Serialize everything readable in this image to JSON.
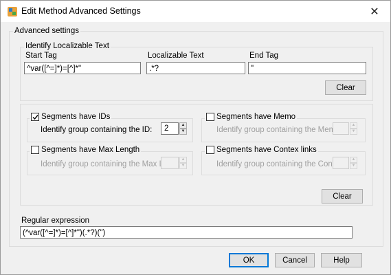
{
  "window": {
    "title": "Edit Method Advanced Settings",
    "close": "✕"
  },
  "advanced": {
    "label": "Advanced settings"
  },
  "localizable": {
    "label": "Identify Localizable Text",
    "start_tag_label": "Start Tag",
    "start_tag_value": "^var([^=]*)=[^]*\"",
    "text_label": "Localizable Text",
    "text_value": ".*?",
    "end_tag_label": "End Tag",
    "end_tag_value": "\"",
    "clear": "Clear"
  },
  "segments": {
    "ids": {
      "label": "Segments have IDs",
      "checked": true,
      "field_label": "Identify group containing the ID:",
      "value": "2"
    },
    "memo": {
      "label": "Segments have Memo",
      "checked": false,
      "field_label": "Identify group containing the Memo:"
    },
    "max_length": {
      "label": "Segments have Max Length",
      "checked": false,
      "field_label": "Identify group containing the Max Length:"
    },
    "context": {
      "label": "Segments have Contex links",
      "checked": false,
      "field_label": "Identify group containing the Context:"
    },
    "clear": "Clear"
  },
  "regex": {
    "label": "Regular expression",
    "value": "(^var([^=]*)=[^]*\")(.*?)(\")"
  },
  "footer": {
    "ok": "OK",
    "cancel": "Cancel",
    "help": "Help"
  }
}
